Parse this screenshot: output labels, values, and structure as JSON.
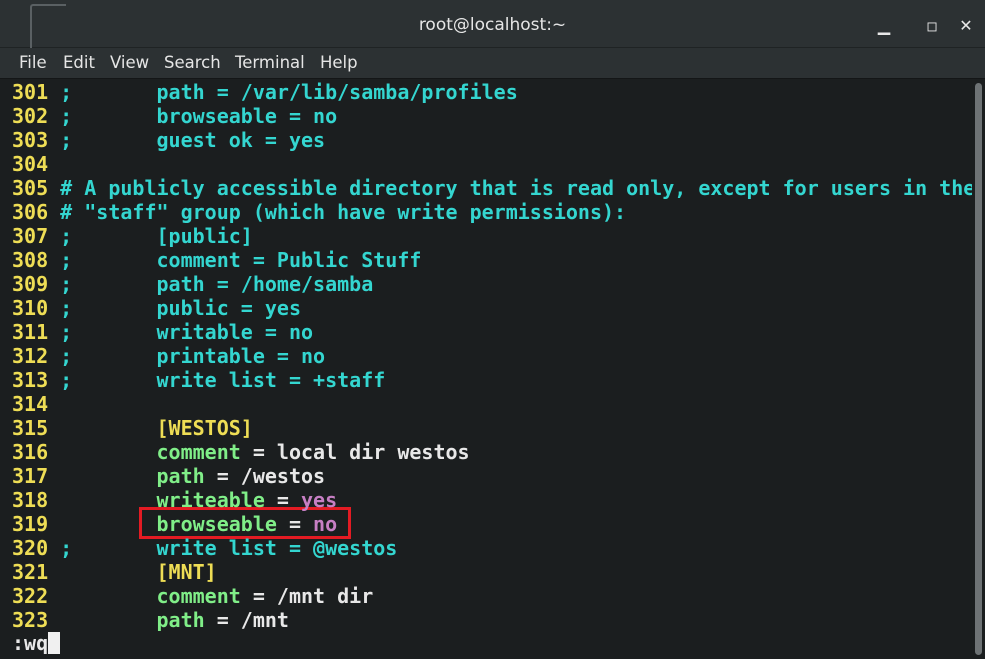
{
  "window": {
    "title": "root@localhost:~"
  },
  "menu": [
    "File",
    "Edit",
    "View",
    "Search",
    "Terminal",
    "Help"
  ],
  "icons": {
    "minimize": "minimize-icon",
    "maximize": "maximize-icon",
    "close": "close-icon"
  },
  "colors": {
    "line_number": "#eedd55",
    "comment": "#34d6d0",
    "keyword": "#80ee88",
    "value": "#c77fc4",
    "highlight_box": "#e31b23"
  },
  "lines": [
    {
      "n": "301",
      "segs": [
        [
          "cy",
          ";       path = /var/lib/samba/profiles"
        ]
      ]
    },
    {
      "n": "302",
      "segs": [
        [
          "cy",
          ";       browseable = no"
        ]
      ]
    },
    {
      "n": "303",
      "segs": [
        [
          "cy",
          ";       guest ok = yes"
        ]
      ]
    },
    {
      "n": "304",
      "segs": []
    },
    {
      "n": "305",
      "segs": [
        [
          "cy",
          "# A publicly accessible directory that is read only, except for users in the"
        ]
      ]
    },
    {
      "n": "306",
      "segs": [
        [
          "cy",
          "# \"staff\" group (which have write permissions):"
        ]
      ]
    },
    {
      "n": "307",
      "segs": [
        [
          "cy",
          ";       [public]"
        ]
      ]
    },
    {
      "n": "308",
      "segs": [
        [
          "cy",
          ";       comment = Public Stuff"
        ]
      ]
    },
    {
      "n": "309",
      "segs": [
        [
          "cy",
          ";       path = /home/samba"
        ]
      ]
    },
    {
      "n": "310",
      "segs": [
        [
          "cy",
          ";       public = yes"
        ]
      ]
    },
    {
      "n": "311",
      "segs": [
        [
          "cy",
          ";       writable = no"
        ]
      ]
    },
    {
      "n": "312",
      "segs": [
        [
          "cy",
          ";       printable = no"
        ]
      ]
    },
    {
      "n": "313",
      "segs": [
        [
          "cy",
          ";       write list = +staff"
        ]
      ]
    },
    {
      "n": "314",
      "segs": []
    },
    {
      "n": "315",
      "segs": [
        [
          "wh",
          "        "
        ],
        [
          "ye",
          "[WESTOS]"
        ]
      ]
    },
    {
      "n": "316",
      "segs": [
        [
          "wh",
          "        "
        ],
        [
          "gr",
          "comment"
        ],
        [
          "wh",
          " = local dir westos"
        ]
      ]
    },
    {
      "n": "317",
      "segs": [
        [
          "wh",
          "        "
        ],
        [
          "gr",
          "path"
        ],
        [
          "wh",
          " = /westos"
        ]
      ]
    },
    {
      "n": "318",
      "segs": [
        [
          "wh",
          "        "
        ],
        [
          "gr",
          "writeable"
        ],
        [
          "wh",
          " = "
        ],
        [
          "pu",
          "yes"
        ]
      ]
    },
    {
      "n": "319",
      "segs": [
        [
          "wh",
          "        "
        ],
        [
          "gr",
          "browseable"
        ],
        [
          "wh",
          " = "
        ],
        [
          "pu",
          "no"
        ]
      ]
    },
    {
      "n": "320",
      "segs": [
        [
          "cy",
          ";       write list = @westos"
        ]
      ]
    },
    {
      "n": "321",
      "segs": [
        [
          "wh",
          "        "
        ],
        [
          "ye",
          "[MNT]"
        ]
      ]
    },
    {
      "n": "322",
      "segs": [
        [
          "wh",
          "        "
        ],
        [
          "gr",
          "comment"
        ],
        [
          "wh",
          " = /mnt dir"
        ]
      ]
    },
    {
      "n": "323",
      "segs": [
        [
          "wh",
          "        "
        ],
        [
          "gr",
          "path"
        ],
        [
          "wh",
          " = /mnt"
        ]
      ]
    }
  ],
  "command_line": ":wq"
}
